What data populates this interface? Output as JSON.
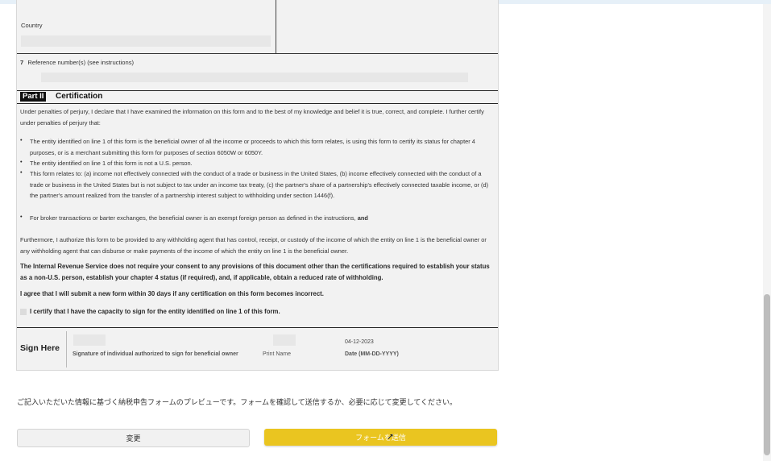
{
  "form": {
    "country_label": "Country",
    "reference_label": "Reference number(s) (see instructions)",
    "reference_num": "7",
    "part_label": "Part II",
    "part_title": "Certification",
    "intro": "Under penalties of perjury, I declare that I have examined the information on this form and to the best of my knowledge and belief it is true, correct, and complete. I further certify under penalties of perjury that:",
    "bullets": [
      "The entity identified on line 1 of this form is the beneficial owner of all the income or proceeds to which this form relates, is using this form to certify its status for chapter 4 purposes, or is a merchant submitting this form for purposes of section 6050W or 6050Y.",
      "The entity identified on line 1 of this form is not a U.S. person.",
      "This form relates to: (a) income not effectively connected with the conduct of a trade or business in the United States, (b) income effectively connected with the conduct of a trade or business in the United States but is not subject to tax under an income tax treaty, (c) the partner's share of a partnership's effectively connected taxable income, or (d) the partner's amount realized from the transfer of a partnership interest subject to withholding under section 1446(f).",
      "For broker transactions or barter exchanges, the beneficial owner is an exempt foreign person as defined in the instructions,"
    ],
    "bullet_and": "and",
    "furthermore": "Furthermore, I authorize this form to be provided to any withholding agent that has control, receipt, or custody of the income of which the entity on line 1 is the beneficial owner or any withholding agent that can disburse or make payments of the income of which the entity on line 1 is the beneficial owner.",
    "irs_statement": "The Internal Revenue Service does not require your consent to any provisions of this document other than the certifications required to establish your status as a non-U.S. person, establish your chapter 4 status (if required), and, if applicable, obtain a reduced rate of withholding.",
    "agree_statement": "I agree that I will submit a new form within 30 days if any certification on this form becomes incorrect.",
    "capacity_statement": "I certify that I have the capacity to sign for the entity identified on line 1 of this form.",
    "sign_here": "Sign Here",
    "signature_caption": "Signature of individual authorized to sign for beneficial owner",
    "print_name_caption": "Print Name",
    "date_value": "04-12-2023",
    "date_caption": "Date (MM-DD-YYYY)"
  },
  "preview_message": "ご記入いただいた情報に基づく納税申告フォームのプレビューです。フォームを確認して送信するか、必要に応じて変更してください。",
  "buttons": {
    "change": "変更",
    "submit": "フォームを送信"
  },
  "colors": {
    "submit": "#eac520",
    "change_bg": "#f1f1f1"
  }
}
